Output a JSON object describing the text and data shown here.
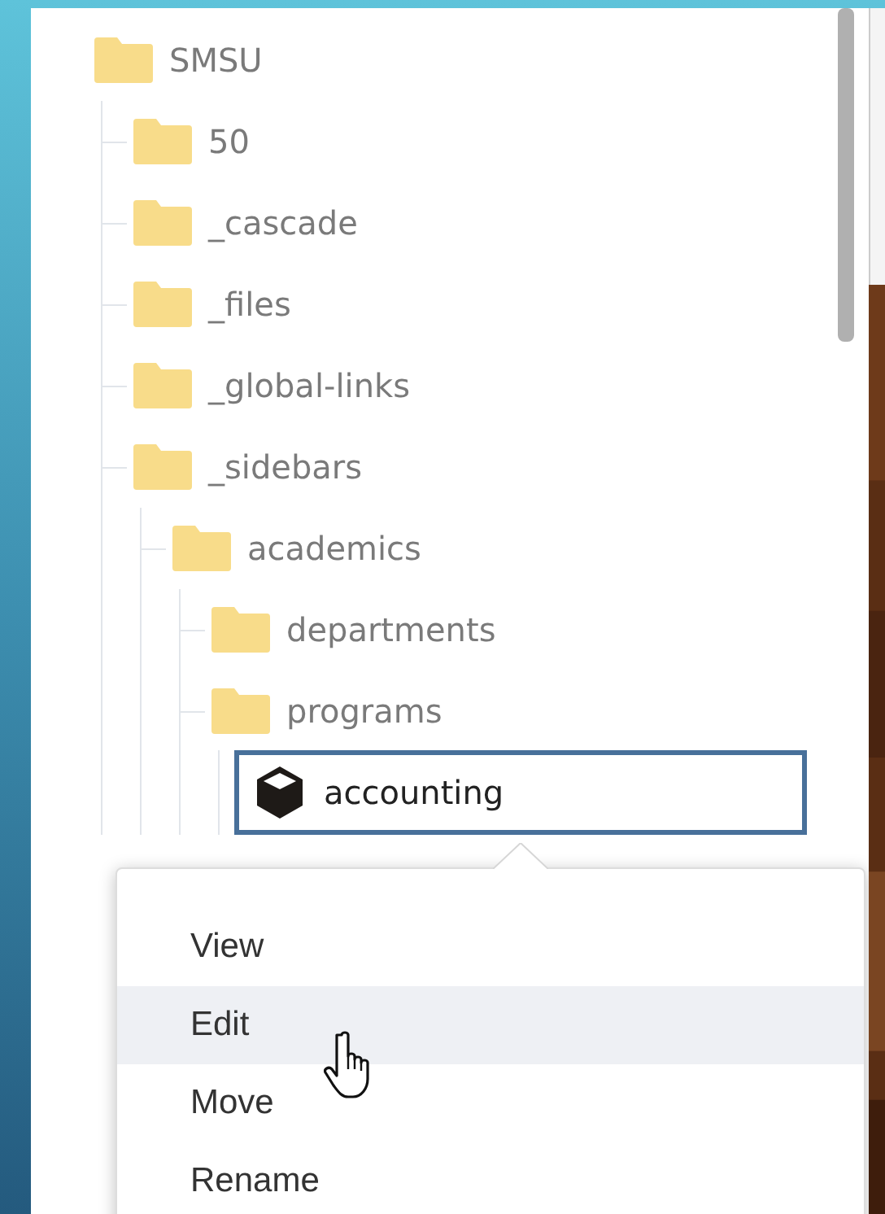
{
  "tree": [
    {
      "label": "SMSU",
      "kind": "folder",
      "selected": false,
      "children": [
        {
          "label": "50",
          "kind": "folder",
          "selected": false
        },
        {
          "label": "_cascade",
          "kind": "folder",
          "selected": false
        },
        {
          "label": "_files",
          "kind": "folder",
          "selected": false
        },
        {
          "label": "_global-links",
          "kind": "folder",
          "selected": false
        },
        {
          "label": "_sidebars",
          "kind": "folder",
          "selected": false,
          "children": [
            {
              "label": "academics",
              "kind": "folder",
              "selected": false,
              "children": [
                {
                  "label": "departments",
                  "kind": "folder",
                  "selected": false
                },
                {
                  "label": "programs",
                  "kind": "folder",
                  "selected": false,
                  "children": [
                    {
                      "label": "accounting",
                      "kind": "asset",
                      "selected": true
                    }
                  ]
                }
              ]
            }
          ]
        }
      ]
    }
  ],
  "context_menu": {
    "items": [
      {
        "label": "View",
        "highlighted": false
      },
      {
        "label": "Edit",
        "highlighted": true
      },
      {
        "label": "Move",
        "highlighted": false
      },
      {
        "label": "Rename",
        "highlighted": false
      }
    ]
  }
}
